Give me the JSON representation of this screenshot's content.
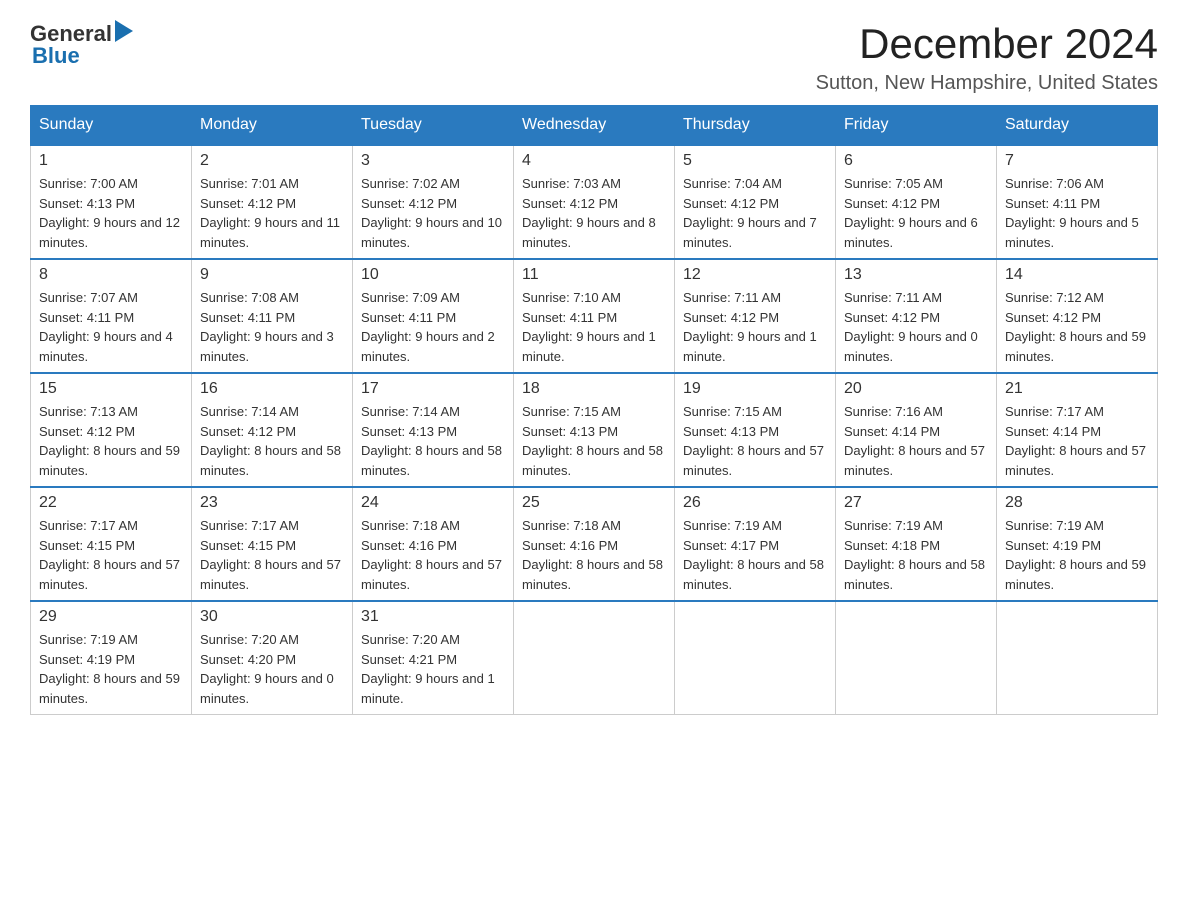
{
  "logo": {
    "general": "General",
    "blue": "Blue"
  },
  "title": "December 2024",
  "location": "Sutton, New Hampshire, United States",
  "headers": [
    "Sunday",
    "Monday",
    "Tuesday",
    "Wednesday",
    "Thursday",
    "Friday",
    "Saturday"
  ],
  "weeks": [
    [
      {
        "day": "1",
        "sunrise": "7:00 AM",
        "sunset": "4:13 PM",
        "daylight": "9 hours and 12 minutes."
      },
      {
        "day": "2",
        "sunrise": "7:01 AM",
        "sunset": "4:12 PM",
        "daylight": "9 hours and 11 minutes."
      },
      {
        "day": "3",
        "sunrise": "7:02 AM",
        "sunset": "4:12 PM",
        "daylight": "9 hours and 10 minutes."
      },
      {
        "day": "4",
        "sunrise": "7:03 AM",
        "sunset": "4:12 PM",
        "daylight": "9 hours and 8 minutes."
      },
      {
        "day": "5",
        "sunrise": "7:04 AM",
        "sunset": "4:12 PM",
        "daylight": "9 hours and 7 minutes."
      },
      {
        "day": "6",
        "sunrise": "7:05 AM",
        "sunset": "4:12 PM",
        "daylight": "9 hours and 6 minutes."
      },
      {
        "day": "7",
        "sunrise": "7:06 AM",
        "sunset": "4:11 PM",
        "daylight": "9 hours and 5 minutes."
      }
    ],
    [
      {
        "day": "8",
        "sunrise": "7:07 AM",
        "sunset": "4:11 PM",
        "daylight": "9 hours and 4 minutes."
      },
      {
        "day": "9",
        "sunrise": "7:08 AM",
        "sunset": "4:11 PM",
        "daylight": "9 hours and 3 minutes."
      },
      {
        "day": "10",
        "sunrise": "7:09 AM",
        "sunset": "4:11 PM",
        "daylight": "9 hours and 2 minutes."
      },
      {
        "day": "11",
        "sunrise": "7:10 AM",
        "sunset": "4:11 PM",
        "daylight": "9 hours and 1 minute."
      },
      {
        "day": "12",
        "sunrise": "7:11 AM",
        "sunset": "4:12 PM",
        "daylight": "9 hours and 1 minute."
      },
      {
        "day": "13",
        "sunrise": "7:11 AM",
        "sunset": "4:12 PM",
        "daylight": "9 hours and 0 minutes."
      },
      {
        "day": "14",
        "sunrise": "7:12 AM",
        "sunset": "4:12 PM",
        "daylight": "8 hours and 59 minutes."
      }
    ],
    [
      {
        "day": "15",
        "sunrise": "7:13 AM",
        "sunset": "4:12 PM",
        "daylight": "8 hours and 59 minutes."
      },
      {
        "day": "16",
        "sunrise": "7:14 AM",
        "sunset": "4:12 PM",
        "daylight": "8 hours and 58 minutes."
      },
      {
        "day": "17",
        "sunrise": "7:14 AM",
        "sunset": "4:13 PM",
        "daylight": "8 hours and 58 minutes."
      },
      {
        "day": "18",
        "sunrise": "7:15 AM",
        "sunset": "4:13 PM",
        "daylight": "8 hours and 58 minutes."
      },
      {
        "day": "19",
        "sunrise": "7:15 AM",
        "sunset": "4:13 PM",
        "daylight": "8 hours and 57 minutes."
      },
      {
        "day": "20",
        "sunrise": "7:16 AM",
        "sunset": "4:14 PM",
        "daylight": "8 hours and 57 minutes."
      },
      {
        "day": "21",
        "sunrise": "7:17 AM",
        "sunset": "4:14 PM",
        "daylight": "8 hours and 57 minutes."
      }
    ],
    [
      {
        "day": "22",
        "sunrise": "7:17 AM",
        "sunset": "4:15 PM",
        "daylight": "8 hours and 57 minutes."
      },
      {
        "day": "23",
        "sunrise": "7:17 AM",
        "sunset": "4:15 PM",
        "daylight": "8 hours and 57 minutes."
      },
      {
        "day": "24",
        "sunrise": "7:18 AM",
        "sunset": "4:16 PM",
        "daylight": "8 hours and 57 minutes."
      },
      {
        "day": "25",
        "sunrise": "7:18 AM",
        "sunset": "4:16 PM",
        "daylight": "8 hours and 58 minutes."
      },
      {
        "day": "26",
        "sunrise": "7:19 AM",
        "sunset": "4:17 PM",
        "daylight": "8 hours and 58 minutes."
      },
      {
        "day": "27",
        "sunrise": "7:19 AM",
        "sunset": "4:18 PM",
        "daylight": "8 hours and 58 minutes."
      },
      {
        "day": "28",
        "sunrise": "7:19 AM",
        "sunset": "4:19 PM",
        "daylight": "8 hours and 59 minutes."
      }
    ],
    [
      {
        "day": "29",
        "sunrise": "7:19 AM",
        "sunset": "4:19 PM",
        "daylight": "8 hours and 59 minutes."
      },
      {
        "day": "30",
        "sunrise": "7:20 AM",
        "sunset": "4:20 PM",
        "daylight": "9 hours and 0 minutes."
      },
      {
        "day": "31",
        "sunrise": "7:20 AM",
        "sunset": "4:21 PM",
        "daylight": "9 hours and 1 minute."
      },
      null,
      null,
      null,
      null
    ]
  ],
  "labels": {
    "sunrise": "Sunrise:",
    "sunset": "Sunset:",
    "daylight": "Daylight:"
  }
}
